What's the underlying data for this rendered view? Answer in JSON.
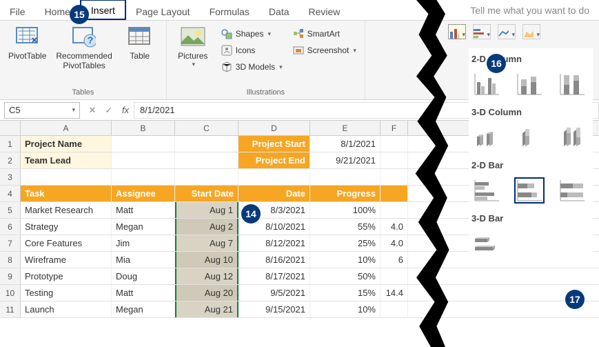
{
  "tabs": {
    "file": "File",
    "home": "Home",
    "insert": "Insert",
    "page_layout": "Page Layout",
    "formulas": "Formulas",
    "data": "Data",
    "review": "Review",
    "tellme": "Tell me what you want to do"
  },
  "ribbon": {
    "tables": {
      "label": "Tables",
      "pivottable": "PivotTable",
      "recommended": "Recommended\nPivotTables",
      "table": "Table"
    },
    "illustrations": {
      "label": "Illustrations",
      "pictures": "Pictures",
      "shapes": "Shapes",
      "icons": "Icons",
      "models": "3D Models",
      "smartart": "SmartArt",
      "screenshot": "Screenshot"
    }
  },
  "namebox": "C5",
  "formula": "8/1/2021",
  "columns": [
    "A",
    "B",
    "C",
    "D",
    "E",
    "F"
  ],
  "rows": [
    {
      "n": "1",
      "A": "Project Name",
      "D": "Project Start",
      "E": "8/1/2021",
      "boldA": true,
      "bgA": "cream",
      "bgD": "orange"
    },
    {
      "n": "2",
      "A": "Team Lead",
      "D": "Project End",
      "E": "9/21/2021",
      "boldA": true,
      "bgA": "cream",
      "bgD": "orange"
    },
    {
      "n": "3"
    },
    {
      "n": "4",
      "A": "Task",
      "B": "Assignee",
      "C": "Start Date",
      "D": "Date",
      "E": "Progress",
      "header": true
    },
    {
      "n": "5",
      "A": "Market Research",
      "B": "Matt",
      "C": "Aug 1",
      "D": "8/3/2021",
      "E": "100%"
    },
    {
      "n": "6",
      "A": "Strategy",
      "B": "Megan",
      "C": "Aug 2",
      "D": "8/10/2021",
      "E": "55%",
      "F": "4.0"
    },
    {
      "n": "7",
      "A": "Core Features",
      "B": "Jim",
      "C": "Aug 7",
      "D": "8/12/2021",
      "E": "25%",
      "F": "4.0"
    },
    {
      "n": "8",
      "A": "Wireframe",
      "B": "Mia",
      "C": "Aug 10",
      "D": "8/16/2021",
      "E": "10%",
      "F": "6"
    },
    {
      "n": "9",
      "A": "Prototype",
      "B": "Doug",
      "C": "Aug 12",
      "D": "8/17/2021",
      "E": "50%"
    },
    {
      "n": "10",
      "A": "Testing",
      "B": "Matt",
      "C": "Aug 20",
      "D": "9/5/2021",
      "E": "15%",
      "F": "14.4"
    },
    {
      "n": "11",
      "A": "Launch",
      "B": "Megan",
      "C": "Aug 21",
      "D": "9/15/2021",
      "E": "10%"
    }
  ],
  "gallery": {
    "col2d": "2-D Column",
    "col3d": "3-D Column",
    "bar2d": "2-D Bar",
    "bar3d": "3-D Bar"
  },
  "annotations": {
    "a14": "14",
    "a15": "15",
    "a16": "16",
    "a17": "17"
  }
}
